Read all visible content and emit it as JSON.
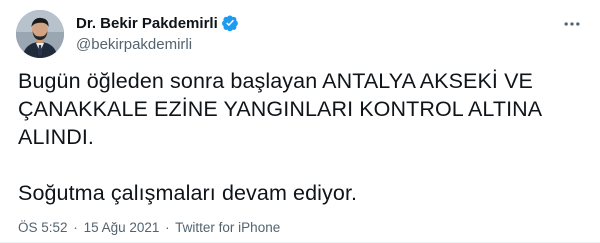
{
  "author": {
    "display_name": "Dr. Bekir Pakdemirli",
    "handle": "@bekirpakdemirli",
    "verified": true,
    "verified_color": "#1d9bf0",
    "avatar_icon": "profile-photo"
  },
  "tweet": {
    "paragraphs": [
      "Bugün öğleden sonra başlayan ANTALYA AKSEKİ VE ÇANAKKALE EZİNE YANGINLARI KONTROL ALTINA ALINDI.",
      "Soğutma çalışmaları devam ediyor."
    ]
  },
  "meta": {
    "time": "ÖS 5:52",
    "separator": "·",
    "date": "15 Ağu 2021",
    "source": "Twitter for iPhone"
  },
  "icons": {
    "more": "more-options-icon",
    "verified": "verified-badge-icon"
  }
}
